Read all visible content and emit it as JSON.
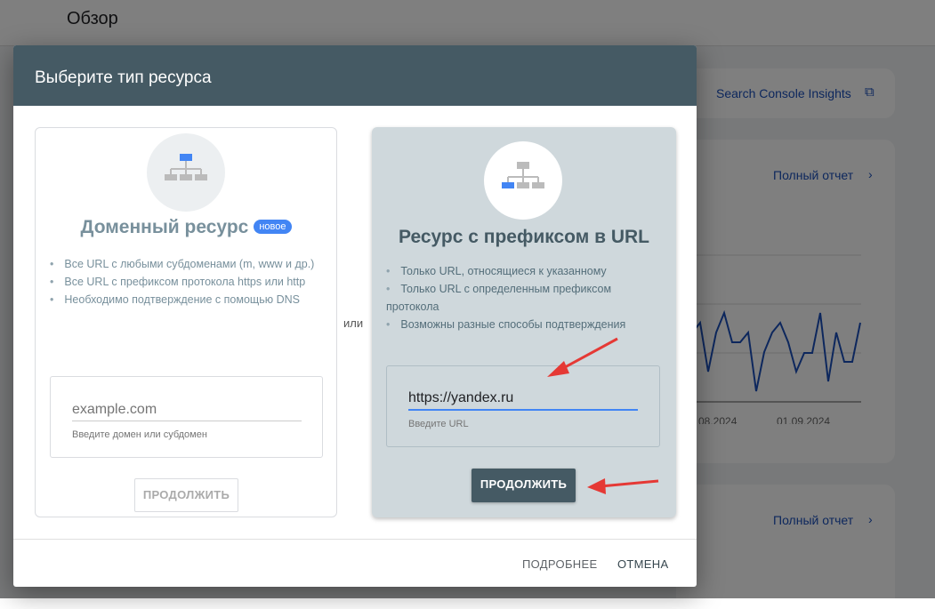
{
  "page": {
    "title": "Обзор"
  },
  "background": {
    "insights_link": "Search Console Insights",
    "full_report_1": "Полный отчет",
    "full_report_2": "Полный отчет",
    "chart_ticks": [
      "08.2024",
      "01.09.2024"
    ],
    "line_color": "#1a4fba"
  },
  "dialog": {
    "title": "Выберите тип ресурса",
    "or_label": "или",
    "domain": {
      "title": "Доменный ресурс",
      "badge": "новое",
      "bullets": [
        "Все URL с любыми субдоменами (m, www и др.)",
        "Все URL с префиксом протокола https или http",
        "Необходимо подтверждение с помощью DNS"
      ],
      "input_value": "",
      "input_placeholder": "example.com",
      "hint": "Введите домен или субдомен",
      "continue": "ПРОДОЛЖИТЬ"
    },
    "prefix": {
      "title": "Ресурс с префиксом в URL",
      "bullets": [
        "Только URL, относящиеся к указанному",
        "Только URL с определенным префиксом протокола",
        "Возможны разные способы подтверждения"
      ],
      "input_value": "https://yandex.ru",
      "hint": "Введите URL",
      "continue": "ПРОДОЛЖИТЬ"
    },
    "footer": {
      "more": "ПОДРОБНЕЕ",
      "cancel": "ОТМЕНА"
    }
  },
  "colors": {
    "header": "#455a64",
    "accent": "#4285f4",
    "arrow": "#e53935"
  }
}
